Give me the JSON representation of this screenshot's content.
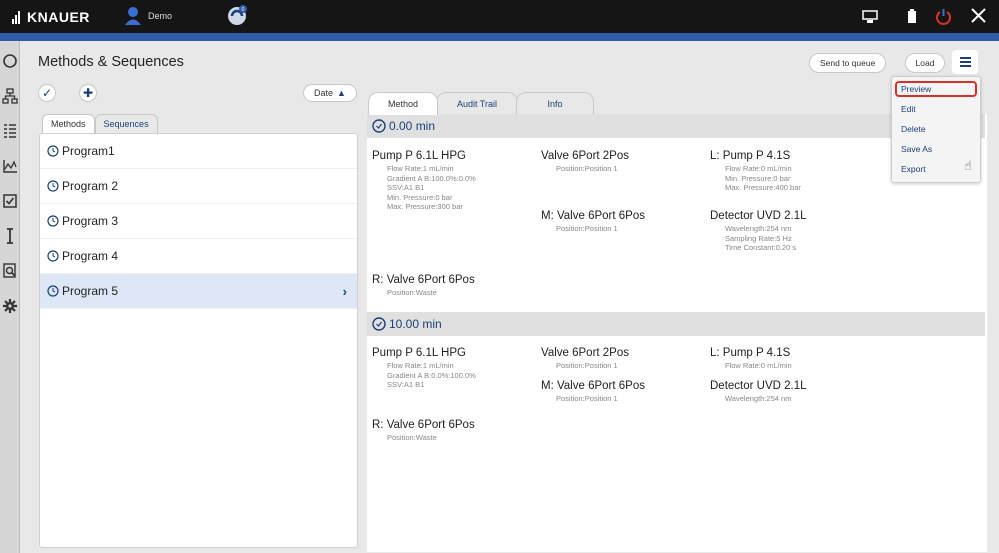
{
  "topbar": {
    "brand": "KNAUER",
    "user": "Demo",
    "icons": [
      "knauer-logo-icon",
      "user-icon",
      "status-icon",
      "monitor-icon",
      "battery-icon",
      "shutdown-icon",
      "close-icon"
    ]
  },
  "sidebar": {
    "items": [
      "circle-icon",
      "network-icon",
      "list-icon",
      "chart-icon",
      "checkbox-icon",
      "instrument-icon",
      "search-document-icon",
      "settings-gear-icon"
    ]
  },
  "page": {
    "title": "Methods & Sequences",
    "date_sort_label": "Date"
  },
  "list_tabs": [
    "Methods",
    "Sequences"
  ],
  "programs": [
    {
      "name": "Program1"
    },
    {
      "name": "Program 2"
    },
    {
      "name": "Program 3"
    },
    {
      "name": "Program 4"
    },
    {
      "name": "Program 5",
      "selected": true
    }
  ],
  "detail_tabs": [
    "Method",
    "Audit Trail",
    "Info"
  ],
  "timepoints": [
    {
      "time": "0.00 min",
      "blocks": [
        {
          "title": "Pump P 6.1L HPG",
          "details": [
            "Flow Rate:1 mL/min",
            "Gradient A B:100.0%:0.0%",
            "SSV:A1 B1",
            "Min. Pressure:0 bar",
            "Max. Pressure:300 bar"
          ]
        },
        {
          "title": "Valve 6Port 2Pos",
          "details": [
            "Position:Position 1"
          ]
        },
        {
          "title": "L: Pump P 4.1S",
          "details": [
            "Flow Rate:0 mL/min",
            "Min. Pressure:0 bar",
            "Max. Pressure:400 bar"
          ]
        },
        {
          "title": "M: Valve 6Port 6Pos",
          "details": [
            "Position:Position 1"
          ]
        },
        {
          "title": "Detector UVD 2.1L",
          "details": [
            "Wavelength:254 nm",
            "Sampling Rate:5 Hz",
            "Time Constant:0.20 s"
          ]
        },
        {
          "title": "R: Valve 6Port 6Pos",
          "details": [
            "Position:Waste"
          ]
        }
      ]
    },
    {
      "time": "10.00 min",
      "blocks": [
        {
          "title": "Pump P 6.1L HPG",
          "details": [
            "Flow Rate:1 mL/min",
            "Gradient A B:0.0%:100.0%",
            "SSV:A1 B1"
          ]
        },
        {
          "title": "Valve 6Port 2Pos",
          "details": [
            "Position:Position 1"
          ]
        },
        {
          "title": "L: Pump P 4.1S",
          "details": [
            "Flow Rate:0 mL/min"
          ]
        },
        {
          "title": "M: Valve 6Port 6Pos",
          "details": [
            "Position:Position 1"
          ]
        },
        {
          "title": "Detector UVD 2.1L",
          "details": [
            "Wavelength:254 nm"
          ]
        },
        {
          "title": "R: Valve 6Port 6Pos",
          "details": [
            "Position:Waste"
          ]
        }
      ]
    }
  ],
  "toolbar": {
    "send_to_queue": "Send to queue",
    "load": "Load"
  },
  "menu": {
    "items": [
      "Preview",
      "Edit",
      "Delete",
      "Save As",
      "Export"
    ],
    "highlighted": "Preview"
  },
  "colors": {
    "topbar": "#151515",
    "accent_blue": "#2e5ca8",
    "link_blue": "#1a3f7a",
    "highlight_red": "#d9302b",
    "selected_row": "#dde7f5"
  }
}
